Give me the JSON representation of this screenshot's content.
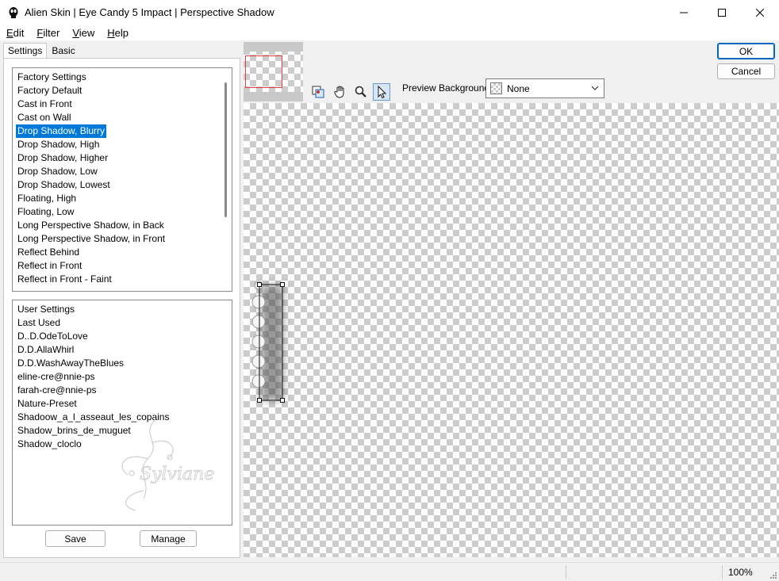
{
  "window": {
    "title": "Alien Skin | Eye Candy 5 Impact | Perspective Shadow"
  },
  "menu": [
    {
      "label": "Edit",
      "key": "E",
      "rest": "dit"
    },
    {
      "label": "Filter",
      "key": "F",
      "rest": "ilter"
    },
    {
      "label": "View",
      "key": "V",
      "rest": "iew"
    },
    {
      "label": "Help",
      "key": "H",
      "rest": "elp"
    }
  ],
  "tabs": {
    "settings": "Settings",
    "basic": "Basic"
  },
  "factory": {
    "header": "Factory Settings",
    "items": [
      "Factory Default",
      "Cast in Front",
      "Cast on Wall",
      "Drop Shadow, Blurry",
      "Drop Shadow, High",
      "Drop Shadow, Higher",
      "Drop Shadow, Low",
      "Drop Shadow, Lowest",
      "Floating, High",
      "Floating, Low",
      "Long Perspective Shadow, in Back",
      "Long Perspective Shadow, in Front",
      "Reflect Behind",
      "Reflect in Front",
      "Reflect in Front - Faint"
    ],
    "selected": "Drop Shadow, Blurry"
  },
  "user": {
    "header": "User Settings",
    "items": [
      "Last Used",
      "D..D.OdeToLove",
      "D.D.AllaWhirl",
      "D.D.WashAwayTheBlues",
      "eline-cre@nnie-ps",
      "farah-cre@nnie-ps",
      "Nature-Preset",
      "Shadoow_a_l_asseaut_les_copains",
      "Shadow_brins_de_muguet",
      "Shadow_cloclo"
    ]
  },
  "buttons": {
    "save": "Save",
    "manage": "Manage",
    "ok": "OK",
    "cancel": "Cancel"
  },
  "preview": {
    "background_label": "Preview Background:",
    "background_value": "None"
  },
  "status": {
    "zoom": "100%"
  },
  "watermark": "Sylviane",
  "colors": {
    "selection": "#0078d7",
    "accent": "#0067c0",
    "nav_rect": "#e04040"
  },
  "icons": [
    "app-icon",
    "minimize-icon",
    "maximize-icon",
    "close-icon",
    "navigate-tool-icon",
    "hand-tool-icon",
    "zoom-tool-icon",
    "pointer-tool-icon",
    "chevron-down-icon"
  ]
}
